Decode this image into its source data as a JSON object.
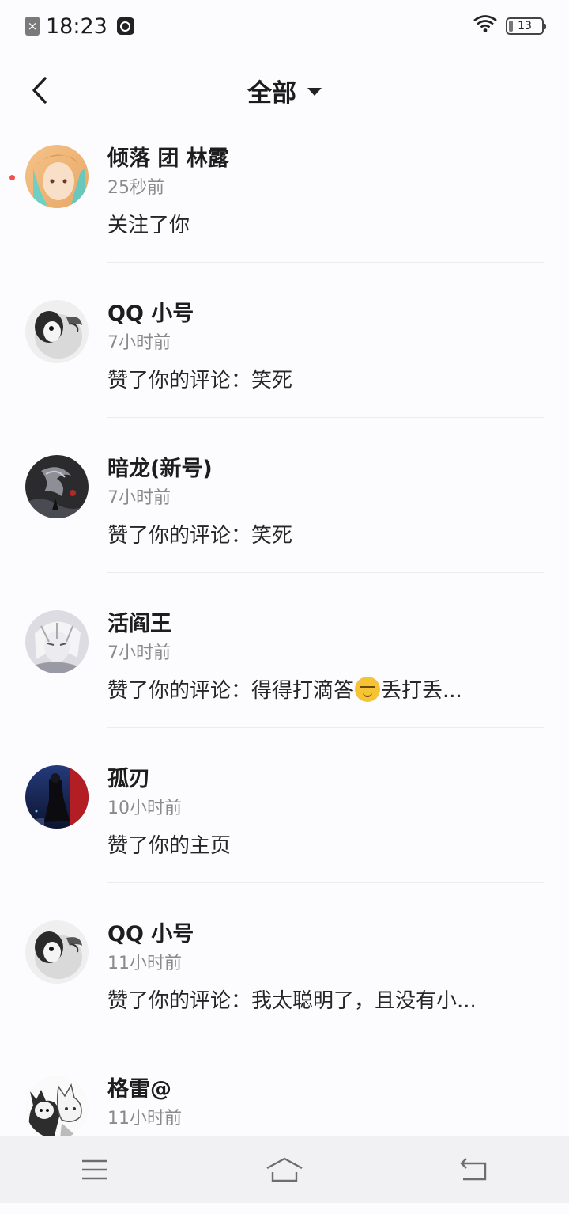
{
  "status_bar": {
    "time": "18:23",
    "battery": "13"
  },
  "header": {
    "title": "全部"
  },
  "notifications": [
    {
      "name": "倾落 团 林露",
      "time": "25秒前",
      "message": "关注了你",
      "unread": true,
      "avatar": "anime-girl-avatar"
    },
    {
      "name": "QQ 小号",
      "time": "7小时前",
      "message": "赞了你的评论：笑死",
      "avatar": "penguin-avatar"
    },
    {
      "name": "暗龙(新号)",
      "time": "7小时前",
      "message": "赞了你的评论：笑死",
      "avatar": "dark-dragon-avatar"
    },
    {
      "name": "活阎王",
      "time": "7小时前",
      "message_before": "赞了你的评论：得得打滴答",
      "message_after": "丢打丢...",
      "emoji": "smirk-emoji",
      "avatar": "anime-boy-avatar"
    },
    {
      "name": "孤刃",
      "time": "10小时前",
      "message": "赞了你的主页",
      "avatar": "night-figure-avatar"
    },
    {
      "name": "QQ 小号",
      "time": "11小时前",
      "message": "赞了你的评论：我太聪明了，且没有小...",
      "avatar": "penguin-avatar"
    },
    {
      "name": "格雷@",
      "time": "11小时前",
      "avatar": "sketch-characters-avatar"
    }
  ],
  "colors": {
    "unread_dot": "#f0524a",
    "background": "#fcfcfe",
    "nav_background": "#f1f1f3"
  }
}
